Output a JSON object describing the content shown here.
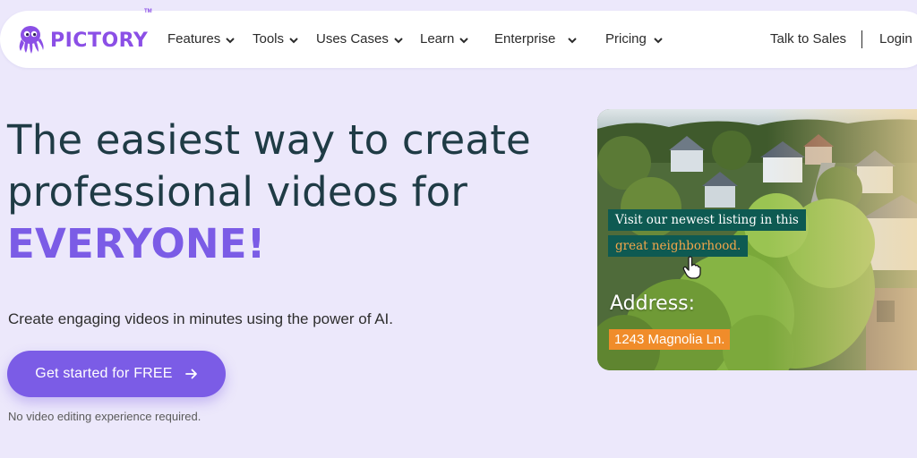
{
  "brand": {
    "name": "PICTORY",
    "trademark": "TM",
    "color": "#8b4fe6"
  },
  "nav": {
    "items": [
      {
        "label": "Features"
      },
      {
        "label": "Tools"
      },
      {
        "label": "Uses Cases"
      },
      {
        "label": "Learn"
      },
      {
        "label": "Enterprise"
      },
      {
        "label": "Pricing"
      }
    ],
    "talk_to_sales": "Talk to Sales",
    "login": "Login"
  },
  "hero": {
    "title_line1": "The easiest way to create",
    "title_line2": "professional videos for",
    "title_accent": "EVERYONE!",
    "subtitle": "Create engaging videos in minutes using the power of AI.",
    "cta_label": "Get started for FREE",
    "note": "No video editing experience required."
  },
  "video_preview": {
    "caption_line1": "Visit our newest listing in this",
    "caption_line2": "great neighborhood.",
    "address_label": "Address:",
    "address_value": "1243 Magnolia Ln."
  },
  "colors": {
    "background": "#ece8fb",
    "accent": "#7b5ce6",
    "title": "#1f3b45",
    "caption_bg": "#0e5a52",
    "caption_highlight": "#f3a64a",
    "address_bg": "#f08c2a"
  },
  "icons": [
    "pictory-octopus-logo",
    "chevron-down-icon",
    "arrow-right-icon",
    "hand-pointer-cursor-icon"
  ]
}
